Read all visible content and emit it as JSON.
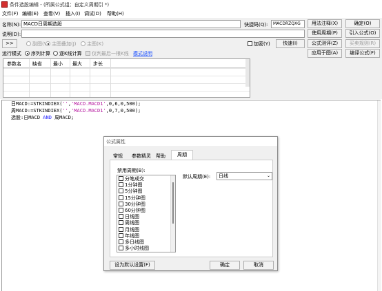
{
  "window": {
    "title": "条件选股编辑 - (所属公式组：自定义周期引 *)"
  },
  "menu": [
    "文件(F)",
    "编辑(E)",
    "查看(V)",
    "插入(I)",
    "调试(D)",
    "帮助(H)"
  ],
  "form": {
    "name_label": "名称(N):",
    "name_value": "MACD日周期选股",
    "code_label": "快捷码(Q):",
    "code_value": "MACDRZQXG",
    "desc_label": "说明(D):",
    "desc_value": "",
    "expand_label": ">>",
    "encrypt_label": "加密(Y)",
    "quick_label": "快速(I)"
  },
  "right_buttons": {
    "usage_note": "用法注释(X)",
    "ok": "确定(O)",
    "use_period": "使用周期(P)",
    "import": "引入公式(O)",
    "test": "公式测评(Z)",
    "buy_sell": "买卖规则(R)",
    "apply_chart": "应用于图(A)",
    "compile": "编译公式(F)"
  },
  "run_mode": {
    "label": "运行模式",
    "opt1": "序列计算",
    "opt2": "逐K线计算",
    "opt3": "仅判最后一根K线",
    "link": "模式说明"
  },
  "draw_mode": {
    "sub": "副图(V)",
    "overlay": "主图叠加(J)",
    "main": "主图(K)"
  },
  "param_table": {
    "headers": [
      "参数名",
      "缺省",
      "最小",
      "最大",
      "步长"
    ]
  },
  "code": {
    "line1_a": "日MACD:=STKINDIEX(",
    "line1_s1": "''",
    "line1_c": ",",
    "line1_s2": "'MACD.MACD1'",
    "line1_d": ",0,6,0,500);",
    "line2_a": "周MACD:=STKINDIEX(",
    "line2_s1": "''",
    "line2_c": ",",
    "line2_s2": "'MACD.MACD1'",
    "line2_d": ",0,7,0,500);",
    "line3_a": "选股:日MACD ",
    "line3_and": "AND",
    "line3_b": " 周MACD;"
  },
  "dialog": {
    "title": "公式属性",
    "tabs": [
      "常规",
      "参数精灵",
      "帮助",
      "周期"
    ],
    "active_tab": "周期",
    "disabled_label": "禁用周期(B):",
    "periods": [
      "分笔成交",
      "1分钟图",
      "5分钟图",
      "15分钟图",
      "30分钟图",
      "60分钟图",
      "日线图",
      "周线图",
      "月线图",
      "年线图",
      "多日线图",
      "多小时线图",
      "多秒线图"
    ],
    "default_label": "默认周期(E):",
    "default_value": "日线",
    "set_default": "设为默认设置(F)",
    "ok": "确定",
    "cancel": "取消"
  },
  "colors": {
    "string": "#b5179e",
    "keyword": "#1a1aff",
    "link": "#1a4fff",
    "accent": "#0078d7"
  }
}
